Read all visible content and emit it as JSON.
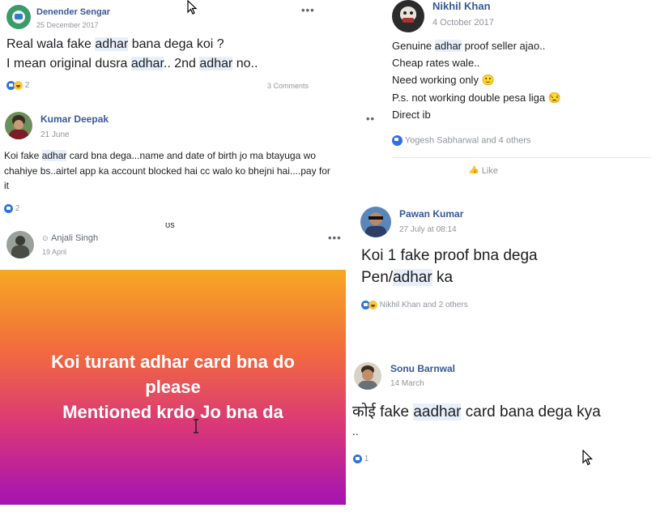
{
  "posts": [
    {
      "author": "Denender Sengar",
      "date": "25 December 2017",
      "lines": [
        [
          "Real wala fake ",
          "adhar",
          " bana dega koi ?"
        ],
        [
          "I mean original dusra ",
          "adhar",
          ".. 2nd ",
          "adhar",
          " no.."
        ]
      ],
      "reaction_count": "2",
      "comments": "3 Comments"
    },
    {
      "author": "Kumar Deepak",
      "date": "21 June",
      "lines": [
        [
          "Koi fake ",
          "adhar",
          " card bna dega...name and date of birth jo ma btayuga wo"
        ],
        [
          "chahiye bs..airtel app ka account blocked hai cc walo ko bhejni hai....pay for"
        ],
        [
          "it"
        ]
      ],
      "reaction_count": "2"
    },
    {
      "author": "Anjali Singh",
      "date": "19 April",
      "background_lines": [
        "Koi turant adhar card bna do",
        "please",
        "Mentioned krdo Jo bna da"
      ]
    },
    {
      "author": "Nikhil Khan",
      "date": "4 October 2017",
      "lines": [
        [
          "Genuine ",
          "adhar",
          " proof seller ajao.."
        ],
        [
          "Cheap rates wale.."
        ],
        [
          "Need working only 🙂"
        ],
        [
          "P.s. not working double pesa liga 😒"
        ],
        [
          "Direct ib"
        ]
      ],
      "reactions": "Yogesh Sabharwal and 4 others",
      "like_label": "Like"
    },
    {
      "author": "Pawan Kumar",
      "date": "27 July at 08:14",
      "lines": [
        [
          "Koi 1 fake proof bna dega"
        ],
        [
          "Pen/",
          "adhar",
          " ka"
        ]
      ],
      "reactions": "Nikhil Khan and 2 others"
    },
    {
      "author": "Sonu Barnwal",
      "date": "14 March",
      "lines": [
        [
          "कोई fake ",
          "aadhar",
          " card bana dega kya"
        ],
        [
          ".."
        ]
      ],
      "reaction_count": "1"
    }
  ],
  "colors": {
    "name": "#385898",
    "like": "#2d72d9",
    "highlight": "#e7effa"
  },
  "icons": [
    "like-icon",
    "haha-icon",
    "more-options-icon",
    "mouse-pointer-icon",
    "text-cursor-icon",
    "globe-icon"
  ]
}
